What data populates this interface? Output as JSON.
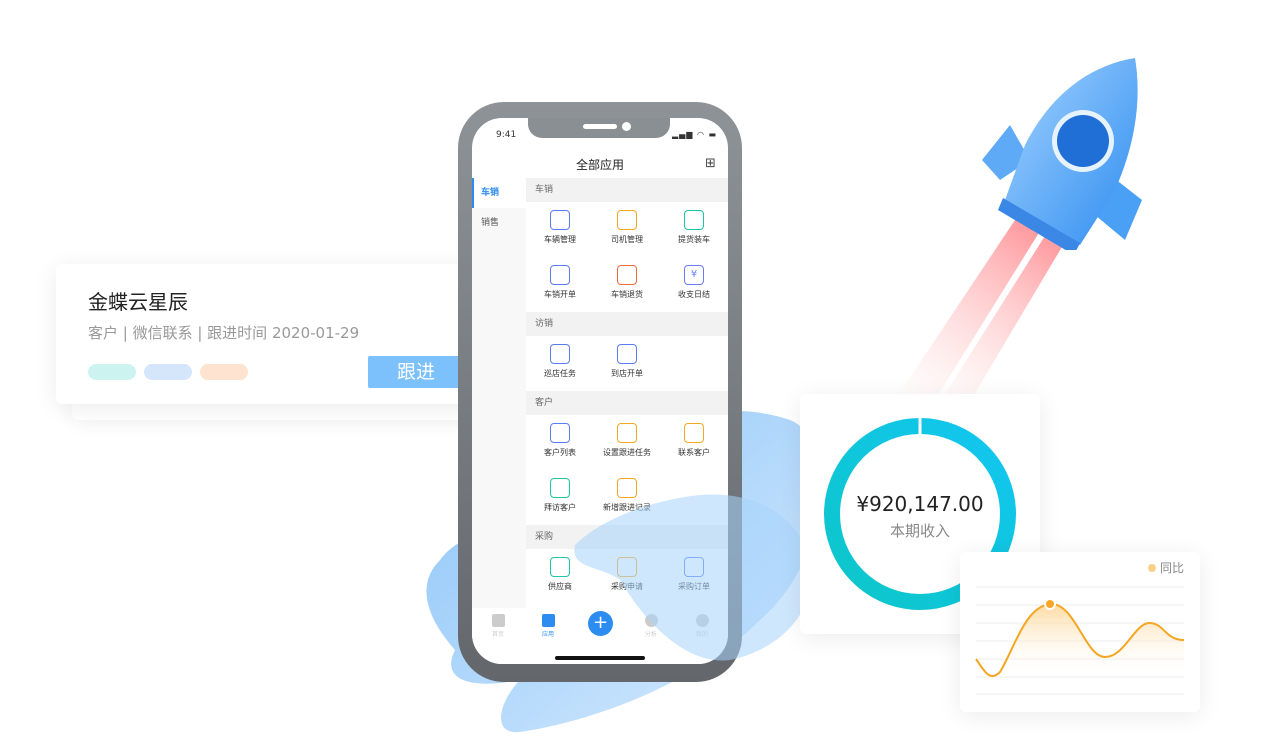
{
  "customer_card": {
    "name": "金蝶云星辰",
    "meta": "客户 | 微信联系 | 跟进时间 2020-01-29",
    "tag_colors": [
      "#cdf3f0",
      "#d5e6fb",
      "#fde3d0"
    ],
    "follow_button": "跟进"
  },
  "phone": {
    "status_time": "9:41",
    "title": "全部应用",
    "sidebar": [
      {
        "label": "车销",
        "active": true
      },
      {
        "label": "销售",
        "active": false
      }
    ],
    "sections": [
      {
        "title": "车销",
        "apps": [
          {
            "label": "车辆管理",
            "icon": "car-icon",
            "color": "#5b7cf6"
          },
          {
            "label": "司机管理",
            "icon": "driver-icon",
            "color": "#f5a623"
          },
          {
            "label": "提货装车",
            "icon": "truck-load-icon",
            "color": "#1cc6a8"
          },
          {
            "label": "车销开单",
            "icon": "order-icon",
            "color": "#5b7cf6"
          },
          {
            "label": "车销退货",
            "icon": "return-icon",
            "color": "#f06a3c"
          },
          {
            "label": "收支日结",
            "icon": "calendar-yen-icon",
            "color": "#6b7cf6"
          }
        ]
      },
      {
        "title": "访销",
        "apps": [
          {
            "label": "巡店任务",
            "icon": "car-icon",
            "color": "#5b7cf6"
          },
          {
            "label": "到店开单",
            "icon": "car-icon",
            "color": "#5b7cf6"
          }
        ]
      },
      {
        "title": "客户",
        "apps": [
          {
            "label": "客户列表",
            "icon": "user-list-icon",
            "color": "#5b7cf6"
          },
          {
            "label": "设置跟进任务",
            "icon": "user-add-icon",
            "color": "#f5a623"
          },
          {
            "label": "联系客户",
            "icon": "contact-book-icon",
            "color": "#f5a623"
          },
          {
            "label": "拜访客户",
            "icon": "calendar-icon",
            "color": "#1cc6a8"
          },
          {
            "label": "新增跟进记录",
            "icon": "record-icon",
            "color": "#f5a623"
          }
        ]
      },
      {
        "title": "采购",
        "apps": [
          {
            "label": "供应商",
            "icon": "supplier-icon",
            "color": "#1cc6a8"
          },
          {
            "label": "采购申请",
            "icon": "purchase-request-icon",
            "color": "#f5a623"
          },
          {
            "label": "采购订单",
            "icon": "purchase-order-icon",
            "color": "#5b7cf6"
          }
        ]
      }
    ],
    "tabs": [
      {
        "label": "首页",
        "icon": "home-icon"
      },
      {
        "label": "应用",
        "icon": "apps-icon",
        "active": true
      },
      {
        "label": "",
        "icon": "plus-icon"
      },
      {
        "label": "分析",
        "icon": "pie-chart-icon"
      },
      {
        "label": "我的",
        "icon": "user-icon"
      }
    ]
  },
  "revenue_card": {
    "amount": "¥920,147.00",
    "label": "本期收入",
    "colors": [
      "#0cc6c8",
      "#12c6f0"
    ]
  },
  "trend_card": {
    "legend": "同比",
    "color": "#f5a623"
  }
}
